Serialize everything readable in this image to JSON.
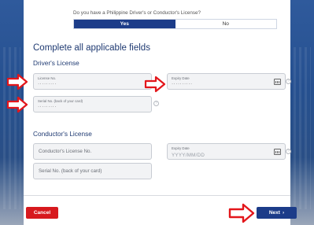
{
  "license_question": {
    "text": "Do you have a Philippine Driver's or Conductor's License?",
    "options": [
      "Yes",
      "No"
    ],
    "selected": "Yes"
  },
  "section_title": "Complete all applicable fields",
  "drivers_license": {
    "heading": "Driver's License",
    "license_no": {
      "label": "License No.",
      "value": "·········"
    },
    "expiry_date": {
      "label": "Expiry Date",
      "value": "··········"
    },
    "serial_no": {
      "label": "Serial No. (back of your card)",
      "value": "·········"
    }
  },
  "conductors_license": {
    "heading": "Conductor's License",
    "license_no": {
      "placeholder": "Conductor's License No."
    },
    "expiry_date": {
      "label": "Expiry Date",
      "placeholder": "YYYY/MM/DD"
    },
    "serial_no": {
      "placeholder": "Serial No. (back of your card)"
    }
  },
  "help_glyph": "?",
  "buttons": {
    "cancel": "Cancel",
    "next": "Next"
  },
  "icons": {
    "next_chevron": "›"
  },
  "colors": {
    "primary": "#1c3c89",
    "cancel": "#d7191e",
    "annotation_arrow": "#e3161b"
  }
}
